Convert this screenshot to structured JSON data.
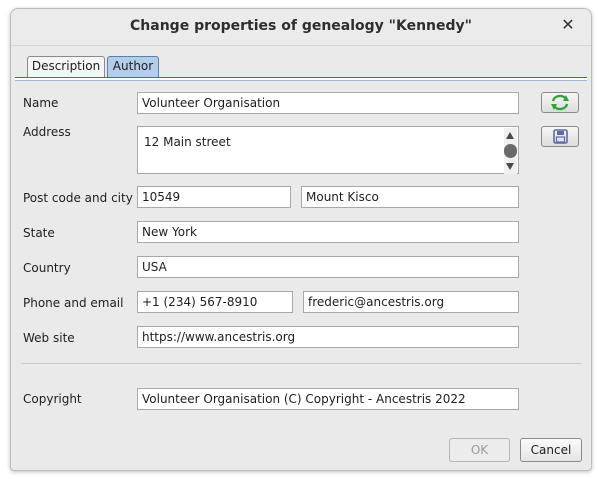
{
  "dialog": {
    "title": "Change properties of genealogy \"Kennedy\"",
    "close_glyph": "✕"
  },
  "tabs": [
    {
      "label": "Description",
      "active": false
    },
    {
      "label": "Author",
      "active": true
    }
  ],
  "form": {
    "name": {
      "label": "Name",
      "value": "Volunteer Organisation"
    },
    "address": {
      "label": "Address",
      "value": "12 Main street"
    },
    "postcode_city": {
      "label": "Post code and city",
      "postcode": "10549",
      "city": "Mount Kisco"
    },
    "state": {
      "label": "State",
      "value": "New York"
    },
    "country": {
      "label": "Country",
      "value": "USA"
    },
    "phone_email": {
      "label": "Phone and email",
      "phone": "+1 (234) 567-8910",
      "email": "frederic@ancestris.org"
    },
    "website": {
      "label": "Web site",
      "value": "https://www.ancestris.org"
    },
    "copyright": {
      "label": "Copyright",
      "value": "Volunteer Organisation (C) Copyright - Ancestris 2022"
    }
  },
  "side_buttons": [
    {
      "icon": "refresh-icon",
      "color": "#2fa43a"
    },
    {
      "icon": "save-floppy-icon",
      "color": "#5c6aa8"
    }
  ],
  "footer": {
    "ok_label": "OK",
    "cancel_label": "Cancel"
  },
  "colors": {
    "active_tab": "#b4cde8",
    "tab_border": "#4a6a9e"
  }
}
